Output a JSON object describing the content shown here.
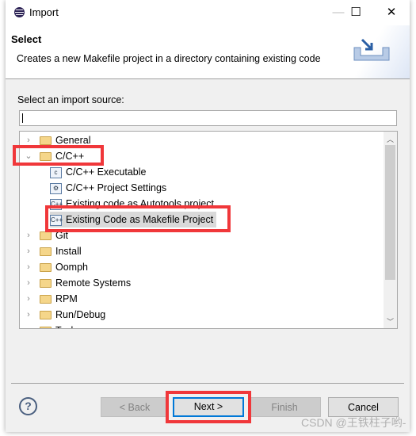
{
  "window": {
    "title": "Import",
    "controls": [
      "minimize",
      "maximize",
      "close"
    ]
  },
  "header": {
    "title": "Select",
    "description": "Creates a new Makefile project in a directory containing existing code",
    "banner_icon": "import-tray-icon"
  },
  "source": {
    "label": "Select an import source:",
    "filter_value": "",
    "tree": [
      {
        "label": "General",
        "expanded": false,
        "level": 0,
        "icon": "folder-icon"
      },
      {
        "label": "C/C++",
        "expanded": true,
        "level": 0,
        "icon": "folder-icon",
        "highlighted": true
      },
      {
        "label": "C/C++ Executable",
        "level": 1,
        "icon": "c-file-icon"
      },
      {
        "label": "C/C++ Project Settings",
        "level": 1,
        "icon": "settings-icon"
      },
      {
        "label": "Existing code as Autotools project",
        "level": 1,
        "icon": "cpp-file-icon"
      },
      {
        "label": "Existing Code as Makefile Project",
        "level": 1,
        "icon": "cpp-file-icon",
        "selected": true,
        "highlighted": true
      },
      {
        "label": "Git",
        "expanded": false,
        "level": 0,
        "icon": "folder-icon"
      },
      {
        "label": "Install",
        "expanded": false,
        "level": 0,
        "icon": "folder-icon"
      },
      {
        "label": "Oomph",
        "expanded": false,
        "level": 0,
        "icon": "folder-icon"
      },
      {
        "label": "Remote Systems",
        "expanded": false,
        "level": 0,
        "icon": "folder-icon"
      },
      {
        "label": "RPM",
        "expanded": false,
        "level": 0,
        "icon": "folder-icon"
      },
      {
        "label": "Run/Debug",
        "expanded": false,
        "level": 0,
        "icon": "folder-icon"
      },
      {
        "label": "Tasks",
        "expanded": false,
        "level": 0,
        "icon": "folder-icon"
      }
    ]
  },
  "buttons": {
    "back": "< Back",
    "next": "Next >",
    "finish": "Finish",
    "cancel": "Cancel",
    "help": "?"
  },
  "watermark": "CSDN @王铁柱子哟-",
  "colors": {
    "highlight_box": "#f0373a",
    "default_button_border": "#0078d7"
  }
}
